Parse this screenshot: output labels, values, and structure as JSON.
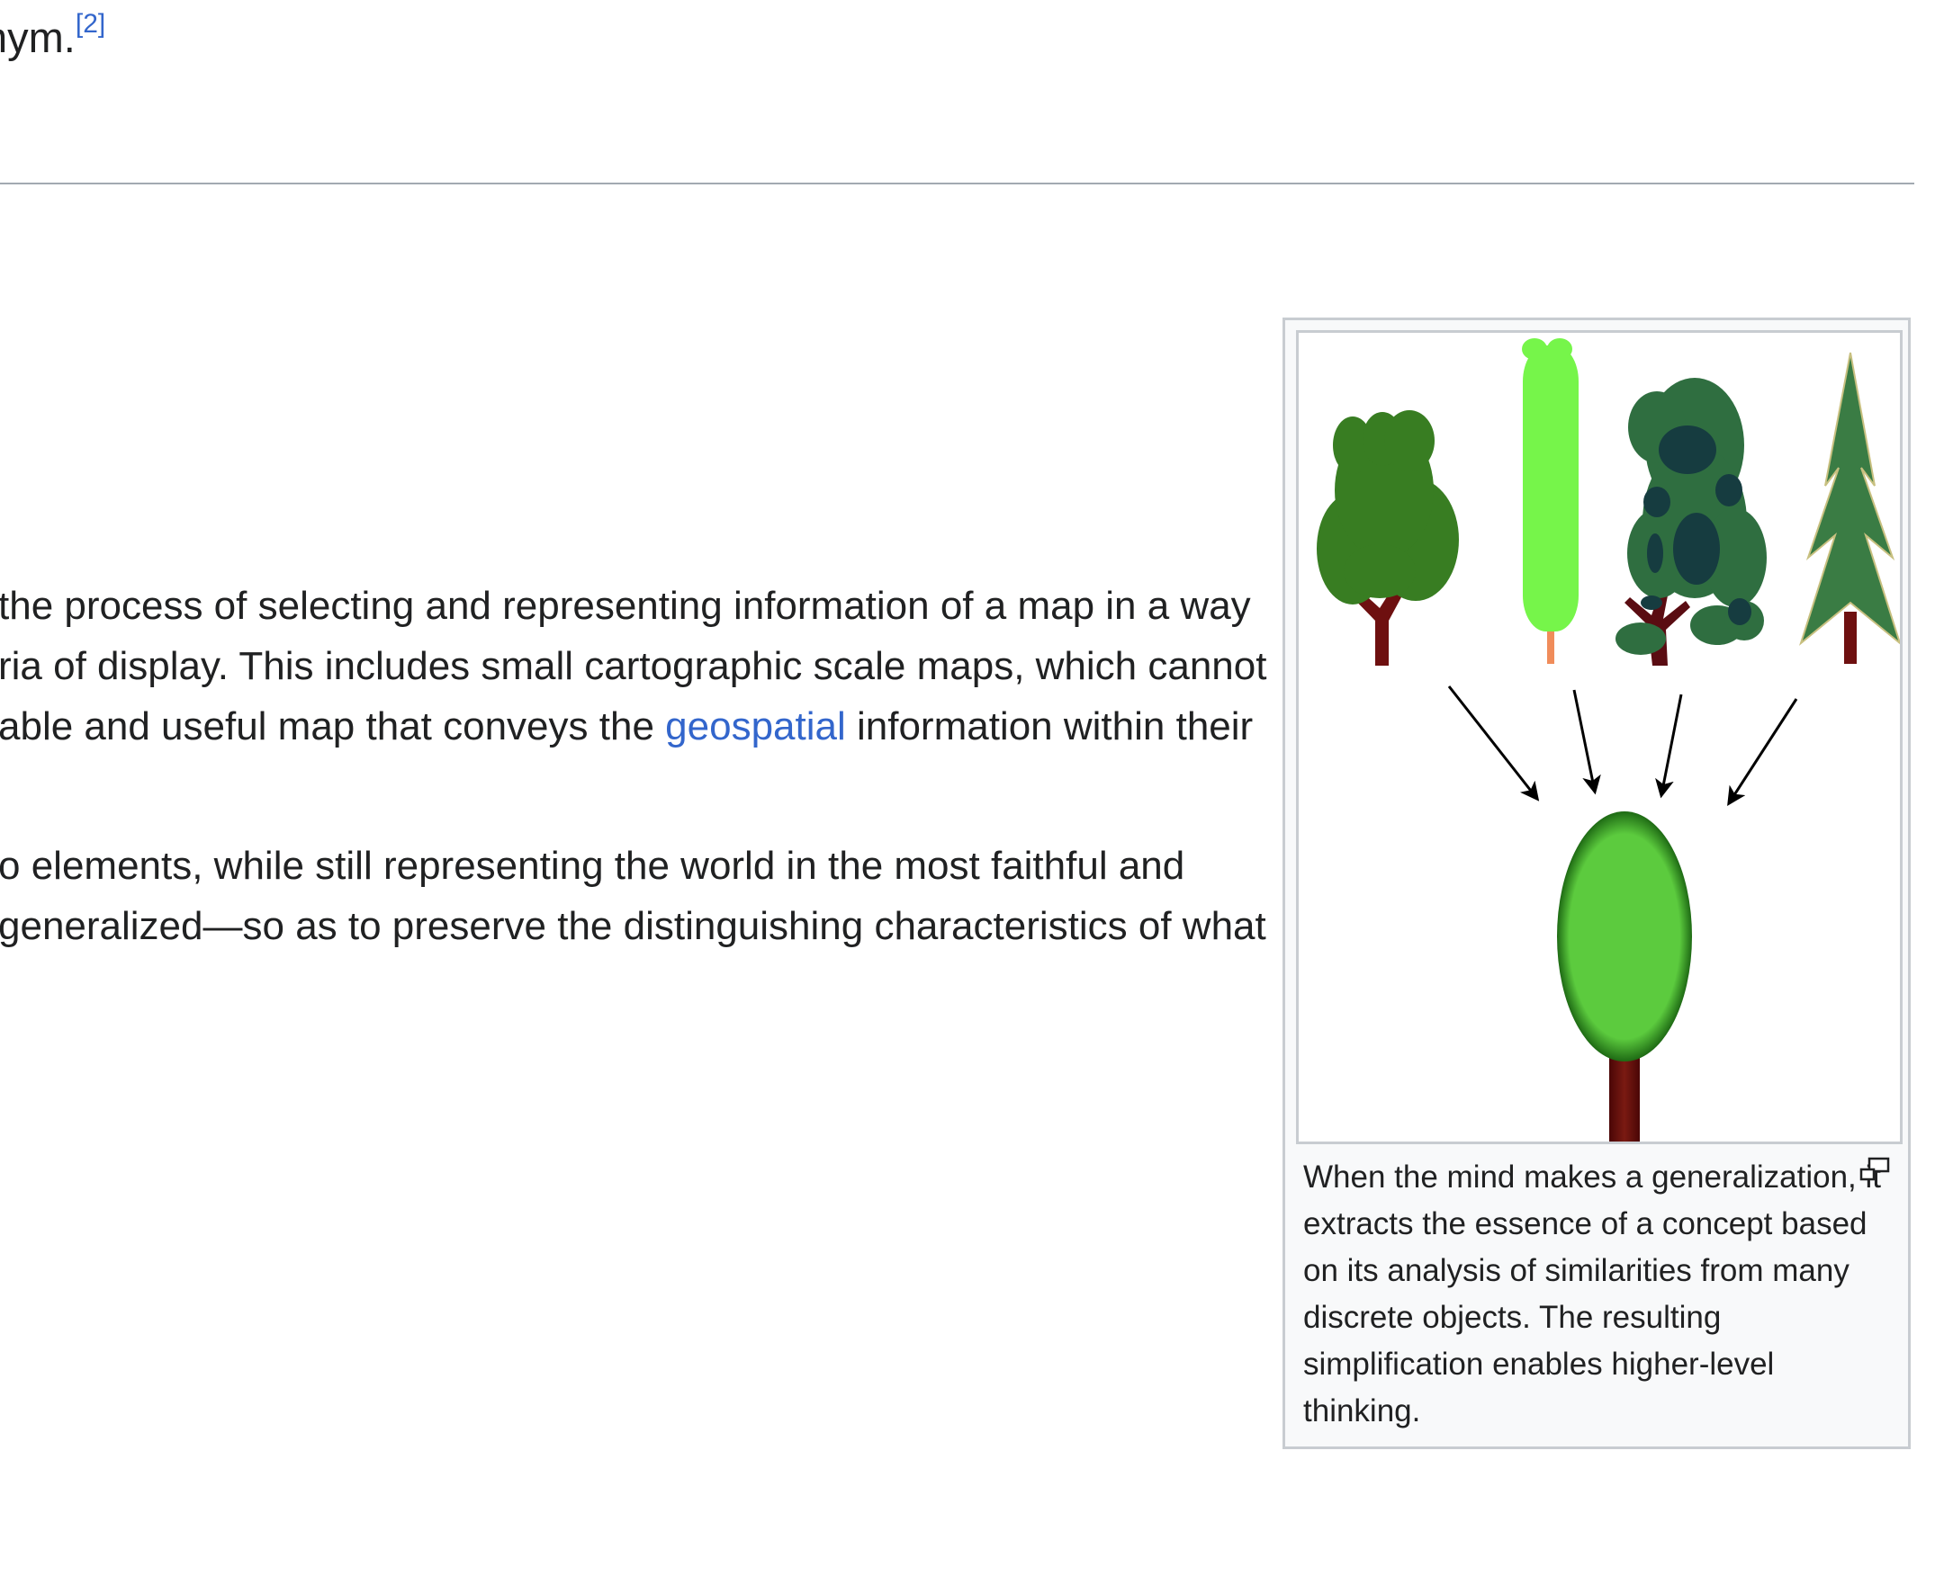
{
  "article": {
    "top_fragment": "nym.",
    "top_ref": "[2]",
    "paragraph1": {
      "line1": "the process of selecting and representing information of a map in a way",
      "line2": "ria of display. This includes small cartographic scale maps, which cannot",
      "line3_before": "able and useful map that conveys the ",
      "line3_link": "geospatial",
      "line3_after": " information within their"
    },
    "paragraph2": {
      "line1": "o elements, while still representing the world in the most faithful and",
      "line2": "generalized—so as to preserve the distinguishing characteristics of what"
    }
  },
  "figure": {
    "caption": "When the mind makes a generalization, it extracts the essence of a concept based on its analysis of similarities from many discrete objects. The resulting simplification enables higher-level thinking.",
    "enlarge_icon": "magnify-clip-icon",
    "colors": {
      "tree1": "#387d22",
      "tree2": "#76f54a",
      "tree3_light": "#2f6e40",
      "tree3_dark": "#163c40",
      "tree4": "#3a7c44",
      "trunk": "#6e1010",
      "result_tree": "#5ccb3e"
    }
  }
}
